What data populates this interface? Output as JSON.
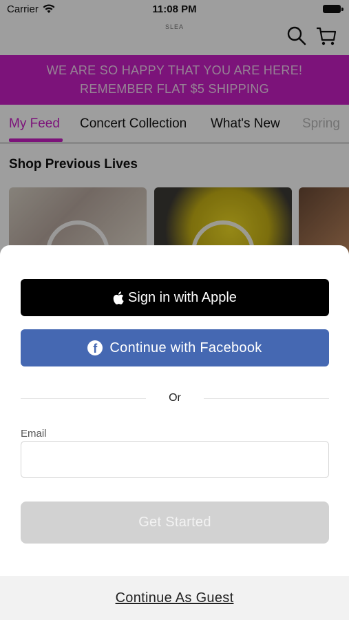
{
  "status_bar": {
    "carrier": "Carrier",
    "time": "11:08 PM"
  },
  "header": {
    "logo_text": "SLEA"
  },
  "promo": {
    "line1": "WE ARE SO HAPPY THAT YOU ARE HERE!",
    "line2": "REMEMBER FLAT $5 SHIPPING",
    "color": "#c81fc6"
  },
  "tabs": [
    {
      "label": "My Feed",
      "active": true
    },
    {
      "label": "Concert Collection"
    },
    {
      "label": "What's New"
    },
    {
      "label": "Spring"
    }
  ],
  "section": {
    "title": "Shop Previous Lives"
  },
  "auth": {
    "apple_label": "Sign in with Apple",
    "facebook_label": "Continue with Facebook",
    "divider_text": "Or",
    "email_label": "Email",
    "email_placeholder": "",
    "get_started_label": "Get Started",
    "guest_label": "Continue As Guest"
  },
  "icons": [
    "wifi-icon",
    "battery-icon",
    "search-icon",
    "cart-icon",
    "play-icon",
    "apple-icon",
    "facebook-icon"
  ],
  "colors": {
    "brand": "#c81fc6",
    "facebook": "#4568b2",
    "apple": "#000000"
  }
}
